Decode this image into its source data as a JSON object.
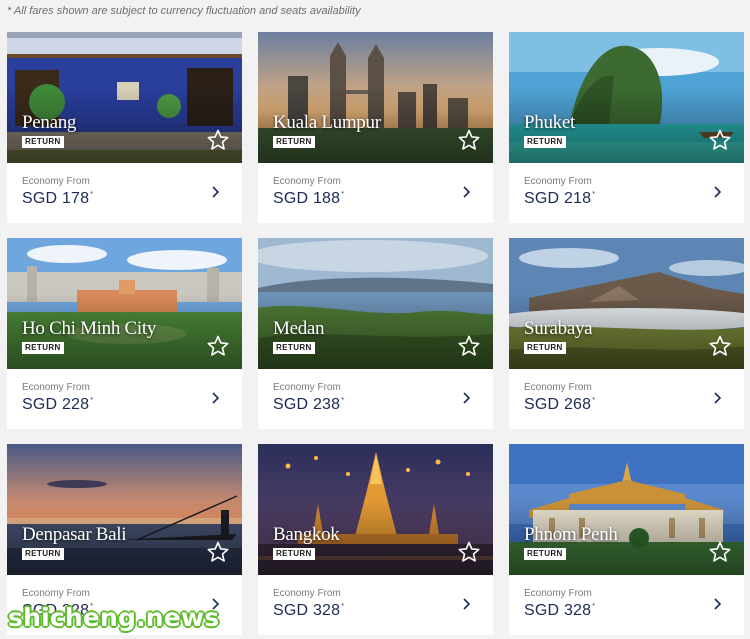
{
  "disclaimer": "* All fares shown are subject to currency fluctuation and seats availability",
  "currency": "SGD",
  "fare_label": "Economy From",
  "badge": "RETURN",
  "colors": {
    "price_text": "#1d2a57",
    "watermark_outline": "#5dbb2c"
  },
  "destinations": [
    {
      "name": "Penang",
      "price": "178"
    },
    {
      "name": "Kuala Lumpur",
      "price": "188"
    },
    {
      "name": "Phuket",
      "price": "218"
    },
    {
      "name": "Ho Chi Minh City",
      "price": "228"
    },
    {
      "name": "Medan",
      "price": "238"
    },
    {
      "name": "Surabaya",
      "price": "268"
    },
    {
      "name": "Denpasar Bali",
      "price": "328"
    },
    {
      "name": "Bangkok",
      "price": "328"
    },
    {
      "name": "Phnom Penh",
      "price": "328"
    }
  ],
  "watermark": "shicheng.news"
}
